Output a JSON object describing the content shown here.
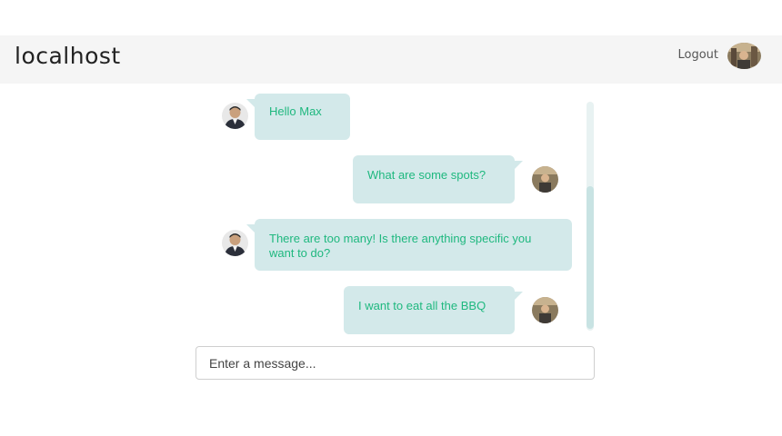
{
  "navbar": {
    "brand": "localhost",
    "logout_label": "Logout",
    "avatar_icon": "user-avatar-icon"
  },
  "chat": {
    "messages": [
      {
        "sender": "other",
        "text": "Hello Max"
      },
      {
        "sender": "self",
        "text": "What are some spots?"
      },
      {
        "sender": "other",
        "text": "There are too many! Is there anything specific you want to do?"
      },
      {
        "sender": "self",
        "text": "I want to eat all the BBQ"
      }
    ]
  },
  "composer": {
    "placeholder": "Enter a message...",
    "value": ""
  },
  "colors": {
    "bubble_background": "#d3e9ea",
    "message_text": "#1fb87f",
    "navbar_background": "#f5f5f5"
  }
}
